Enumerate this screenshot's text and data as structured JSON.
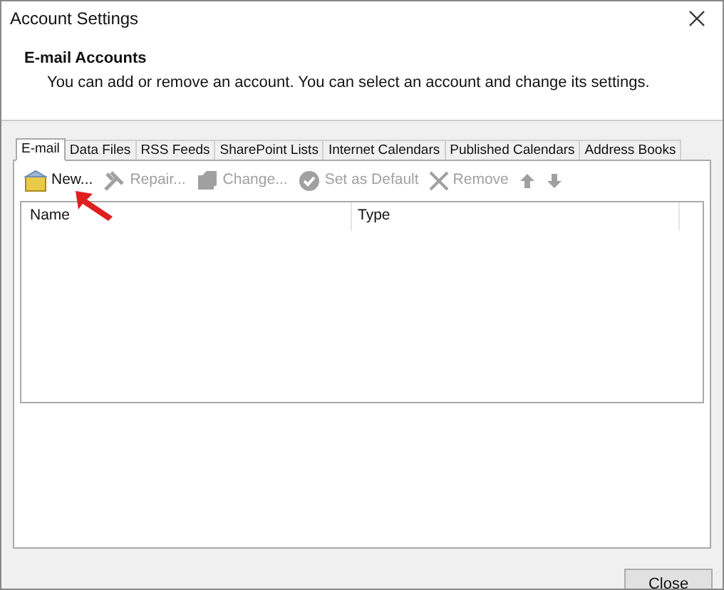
{
  "window": {
    "title": "Account Settings"
  },
  "header": {
    "title": "E-mail Accounts",
    "description": "You can add or remove an account. You can select an account and change its settings."
  },
  "tabs": [
    {
      "label": "E-mail",
      "selected": true
    },
    {
      "label": "Data Files",
      "selected": false
    },
    {
      "label": "RSS Feeds",
      "selected": false
    },
    {
      "label": "SharePoint Lists",
      "selected": false
    },
    {
      "label": "Internet Calendars",
      "selected": false
    },
    {
      "label": "Published Calendars",
      "selected": false
    },
    {
      "label": "Address Books",
      "selected": false
    }
  ],
  "toolbar": [
    {
      "kind": "new",
      "label": "New...",
      "disabled": false
    },
    {
      "kind": "repair",
      "label": "Repair...",
      "disabled": true
    },
    {
      "kind": "change",
      "label": "Change...",
      "disabled": true
    },
    {
      "kind": "default",
      "label": "Set as Default",
      "disabled": true
    },
    {
      "kind": "remove",
      "label": "Remove",
      "disabled": true
    },
    {
      "kind": "up",
      "disabled": true
    },
    {
      "kind": "down",
      "disabled": true
    }
  ],
  "table": {
    "columns": [
      "Name",
      "Type"
    ]
  },
  "buttons": [
    "Close"
  ]
}
